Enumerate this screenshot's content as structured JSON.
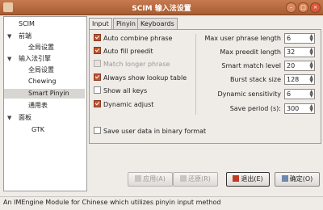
{
  "window": {
    "title": "SCIM 输入法设置"
  },
  "sidebar": {
    "items": [
      {
        "label": "SCIM",
        "level": 0,
        "expanded": null,
        "selected": false
      },
      {
        "label": "前端",
        "level": 0,
        "expanded": true,
        "selected": false
      },
      {
        "label": "全局设置",
        "level": 1,
        "expanded": null,
        "selected": false
      },
      {
        "label": "输入法引擎",
        "level": 0,
        "expanded": true,
        "selected": false
      },
      {
        "label": "全局设置",
        "level": 1,
        "expanded": null,
        "selected": false
      },
      {
        "label": "Chewing",
        "level": 1,
        "expanded": null,
        "selected": false
      },
      {
        "label": "Smart Pinyin",
        "level": 1,
        "expanded": null,
        "selected": true
      },
      {
        "label": "通用表",
        "level": 1,
        "expanded": null,
        "selected": false
      },
      {
        "label": "面板",
        "level": 0,
        "expanded": true,
        "selected": false
      },
      {
        "label": "GTK",
        "level": 1,
        "expanded": null,
        "selected": false
      }
    ]
  },
  "tabs": [
    {
      "label": "Input",
      "active": true
    },
    {
      "label": "Pinyin",
      "active": false
    },
    {
      "label": "Keyboards",
      "active": false
    }
  ],
  "checkboxes": [
    {
      "label": "Auto combine phrase",
      "checked": true,
      "enabled": true
    },
    {
      "label": "Auto fill preedit",
      "checked": true,
      "enabled": true
    },
    {
      "label": "Match longer phrase",
      "checked": false,
      "enabled": false
    },
    {
      "label": "Always show lookup table",
      "checked": true,
      "enabled": true
    },
    {
      "label": "Show all keys",
      "checked": false,
      "enabled": true
    },
    {
      "label": "Dynamic adjust",
      "checked": true,
      "enabled": true
    }
  ],
  "save_binary": {
    "label": "Save user data in binary format",
    "checked": false
  },
  "settings": [
    {
      "label": "Max user phrase length",
      "value": "6"
    },
    {
      "label": "Max preedit length",
      "value": "32"
    },
    {
      "label": "Smart match level",
      "value": "20"
    },
    {
      "label": "Burst stack size",
      "value": "128"
    },
    {
      "label": "Dynamic sensitivity",
      "value": "6"
    },
    {
      "label": "Save period (s):",
      "value": "300"
    }
  ],
  "buttons": {
    "apply": "应用(A)",
    "restore": "还原(R)",
    "exit": "退出(E)",
    "ok": "确定(O)"
  },
  "status": {
    "text": "An IMEngine Module for Chinese which utilizes pinyin input method"
  }
}
